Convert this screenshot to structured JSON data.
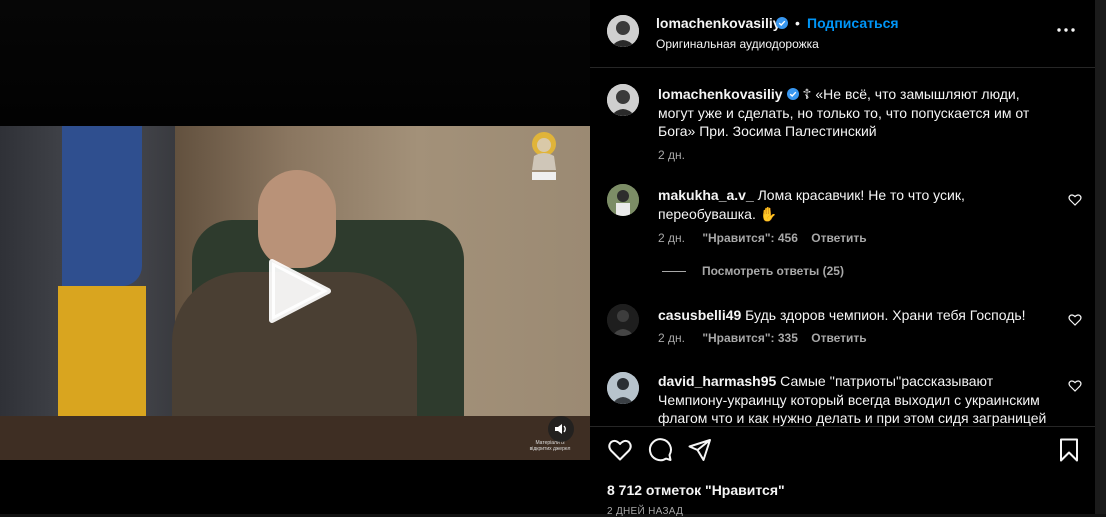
{
  "post": {
    "username": "lomachenkovasiliy",
    "follow_label": "Подписаться",
    "dot": "•",
    "audio_label": "Оригинальная аудиодорожка",
    "more_icon": "more-horizontal-icon"
  },
  "video": {
    "watermark_text": "Матеріали із відкритих джерел",
    "play_icon": "play-icon",
    "mute_icon": "speaker-icon",
    "channel_logo": "saint-icon-logo"
  },
  "caption": {
    "username": "lomachenkovasiliy",
    "text": " ☦ «Не всё, что замышляют люди, могут уже и сделать, но только то, что попускается им от Бога» При. Зосима Палестинский",
    "time": "2 дн."
  },
  "comments": [
    {
      "username": "makukha_a.v_",
      "text": " Лома красавчик! Не то что усик, переобувашка. ✋",
      "time": "2 дн.",
      "likes": "\"Нравится\": 456",
      "reply": "Ответить"
    },
    {
      "username": "casusbelli49",
      "text": " Будь здоров чемпион. Храни тебя Господь!",
      "time": "2 дн.",
      "likes": "\"Нравится\": 335",
      "reply": "Ответить"
    },
    {
      "username": "david_harmash95",
      "text": " Самые ''патриоты''рассказывают Чемпиону-украинцу который всегда выходил с украинским флагом что и как нужно делать и при этом сидя заграницей"
    }
  ],
  "view_replies_label": "Посмотреть ответы (25)",
  "actions": {
    "like_icon": "heart-icon",
    "comment_icon": "comment-icon",
    "share_icon": "share-icon",
    "save_icon": "bookmark-icon"
  },
  "likes_count": "8 712 отметок \"Нравится\"",
  "date": "2 ДНЕЙ НАЗАД",
  "colors": {
    "accent": "#0095f6",
    "verified": "#3897f0",
    "text": "#f5f5f5",
    "secondary": "#a8a8a8"
  }
}
